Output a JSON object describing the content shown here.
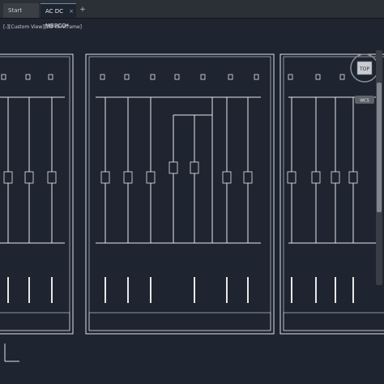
{
  "tabs": [
    {
      "label": "Start",
      "active": false
    },
    {
      "label": "AC DC MBPCO*",
      "active": true
    }
  ],
  "viewport": {
    "label": "[-][Custom View][2D Wireframe]"
  },
  "navcube": {
    "face_label": "TOP",
    "wcs_label": "WCS"
  },
  "colors": {
    "background": "#1e2430",
    "frame_line": "#dfe3e8",
    "bus_line": "#e8e8e8",
    "accent_tab": "#6b8cb8"
  },
  "icons": [
    "close-icon",
    "plus-icon",
    "compass-icon",
    "ucs-icon"
  ]
}
